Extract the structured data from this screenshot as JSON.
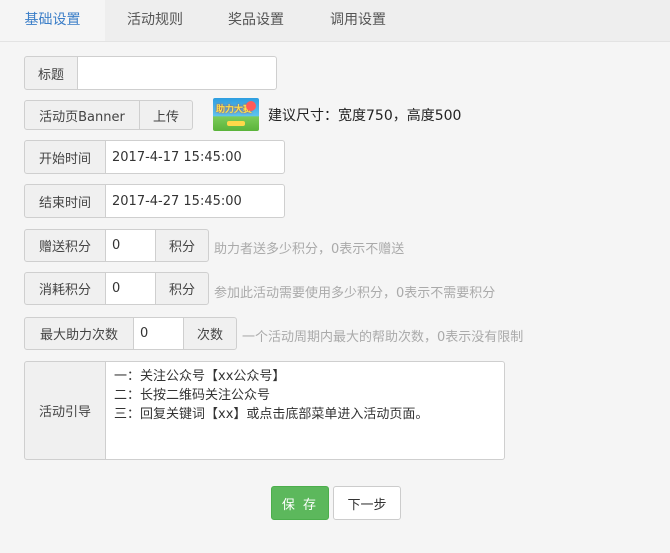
{
  "tabs": [
    {
      "label": "基础设置",
      "active": true
    },
    {
      "label": "活动规则",
      "active": false
    },
    {
      "label": "奖品设置",
      "active": false
    },
    {
      "label": "调用设置",
      "active": false
    }
  ],
  "form": {
    "title": {
      "label": "标题",
      "value": ""
    },
    "banner": {
      "label": "活动页Banner",
      "upload_label": "上传",
      "thumb_text": "助力大赛",
      "size_note": "建议尺寸：宽度750，高度500"
    },
    "start_time": {
      "label": "开始时间",
      "value": "2017-4-17 15:45:00"
    },
    "end_time": {
      "label": "结束时间",
      "value": "2017-4-27 15:45:00"
    },
    "gift_points": {
      "label": "赠送积分",
      "value": "0",
      "unit": "积分",
      "hint": "助力者送多少积分，0表示不赠送"
    },
    "consume_points": {
      "label": "消耗积分",
      "value": "0",
      "unit": "积分",
      "hint": "参加此活动需要使用多少积分，0表示不需要积分"
    },
    "max_help": {
      "label": "最大助力次数",
      "value": "0",
      "unit": "次数",
      "hint": "一个活动周期内最大的帮助次数，0表示没有限制"
    },
    "guide": {
      "label": "活动引导",
      "lines": [
        "一：关注公众号【xx公众号】",
        "二：长按二维码关注公众号",
        "三：回复关键词【xx】或点击底部菜单进入活动页面。"
      ]
    }
  },
  "buttons": {
    "save_label": "保 存",
    "next_label": "下一步"
  },
  "colors": {
    "active_tab": "#3b7ec8",
    "save_button": "#5cb85c",
    "hint_text": "#aaaaaa"
  }
}
